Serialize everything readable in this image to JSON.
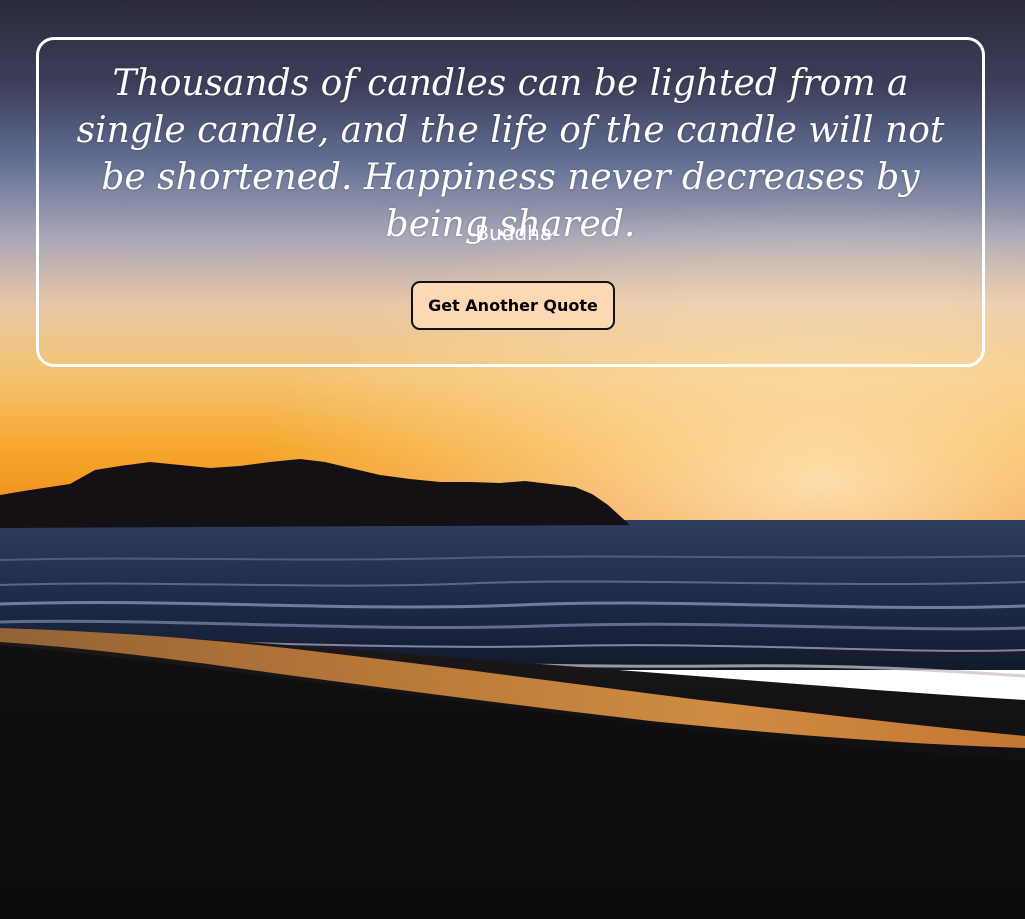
{
  "quote": {
    "text": "Thousands of candles can be lighted from a single candle, and the life of the candle will not be shortened. Happiness never decreases by being shared.",
    "author": "-Buddha"
  },
  "controls": {
    "new_quote_label": "Get Another Quote"
  },
  "colors": {
    "card_border": "#ffffff",
    "quote_text": "#ffffff",
    "button_background": "#fdd8b5",
    "button_border": "#111111",
    "sky_top": "#2b2b3c",
    "horizon_glow": "#f6a623",
    "sea": "#1d2a47",
    "sand": "#0d0d0f"
  },
  "background": {
    "description_icon": "sunset-beach-photo"
  }
}
